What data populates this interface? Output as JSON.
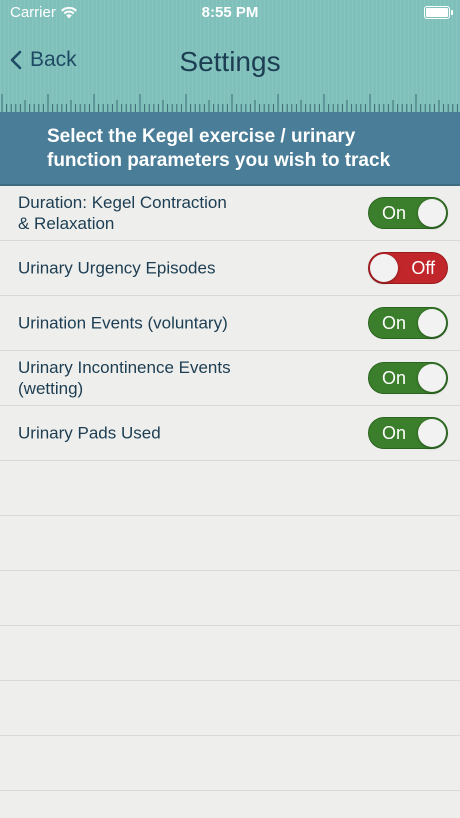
{
  "status_bar": {
    "carrier": "Carrier",
    "time": "8:55 PM",
    "wifi_icon": "wifi-icon",
    "battery_icon": "battery-icon"
  },
  "nav": {
    "back_label": "Back",
    "title": "Settings"
  },
  "banner": {
    "line1": "Select the Kegel exercise / urinary",
    "line2": "function parameters you wish to track"
  },
  "settings": [
    {
      "line1": "Duration: Kegel Contraction",
      "line2": "& Relaxation",
      "state": "On"
    },
    {
      "line1": "Urinary Urgency Episodes",
      "line2": "",
      "state": "Off"
    },
    {
      "line1": "Urination Events (voluntary)",
      "line2": "",
      "state": "On"
    },
    {
      "line1": "Urinary Incontinence Events",
      "line2": "(wetting)",
      "state": "On"
    },
    {
      "line1": "Urinary Pads Used",
      "line2": "",
      "state": "On"
    }
  ],
  "colors": {
    "header": "#7fc0bb",
    "banner": "#4a7e98",
    "toggle_on": "#3b7f2c",
    "toggle_off": "#c1262a",
    "text": "#1c3d52"
  }
}
